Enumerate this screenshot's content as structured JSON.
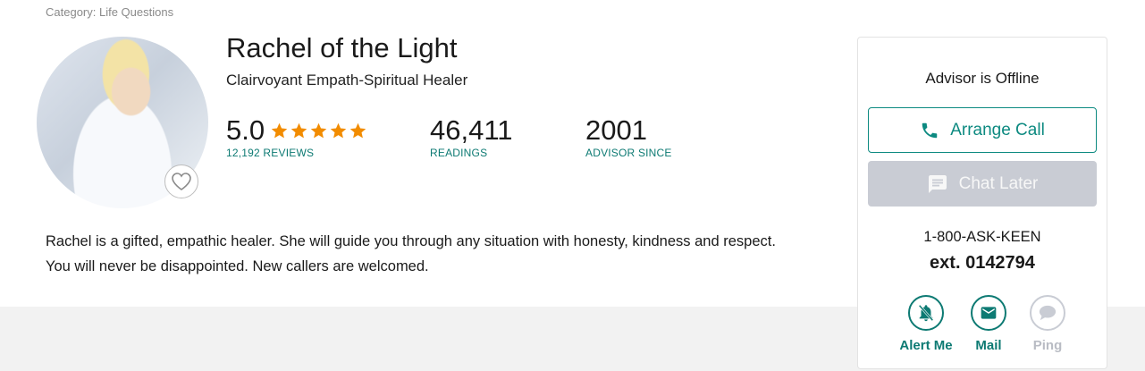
{
  "category": "Category: Life Questions",
  "advisor": {
    "name": "Rachel of the Light",
    "title": "Clairvoyant Empath-Spiritual Healer",
    "rating": "5.0",
    "rating_fraction": 1.0,
    "reviews_label": "12,192 REVIEWS",
    "readings_value": "46,411",
    "readings_label": "READINGS",
    "since_value": "2001",
    "since_label": "ADVISOR SINCE",
    "bio_line1": "Rachel is a gifted, empathic healer. She will guide you through any situation with honesty, kindness and respect.",
    "bio_line2": "You will never be disappointed. New callers are welcomed."
  },
  "panel": {
    "status": "Advisor is Offline",
    "call_label": "Arrange Call",
    "chat_label": "Chat Later",
    "phone": "1-800-ASK-KEEN",
    "ext": "ext. 0142794",
    "actions": [
      {
        "label": "Alert Me",
        "icon": "bell-off-icon"
      },
      {
        "label": "Mail",
        "icon": "mail-icon"
      },
      {
        "label": "Ping",
        "icon": "chat-bubble-icon"
      }
    ]
  },
  "colors": {
    "accent": "#0d8a81",
    "star": "#f28c00",
    "disabled": "#c9ccd4"
  }
}
